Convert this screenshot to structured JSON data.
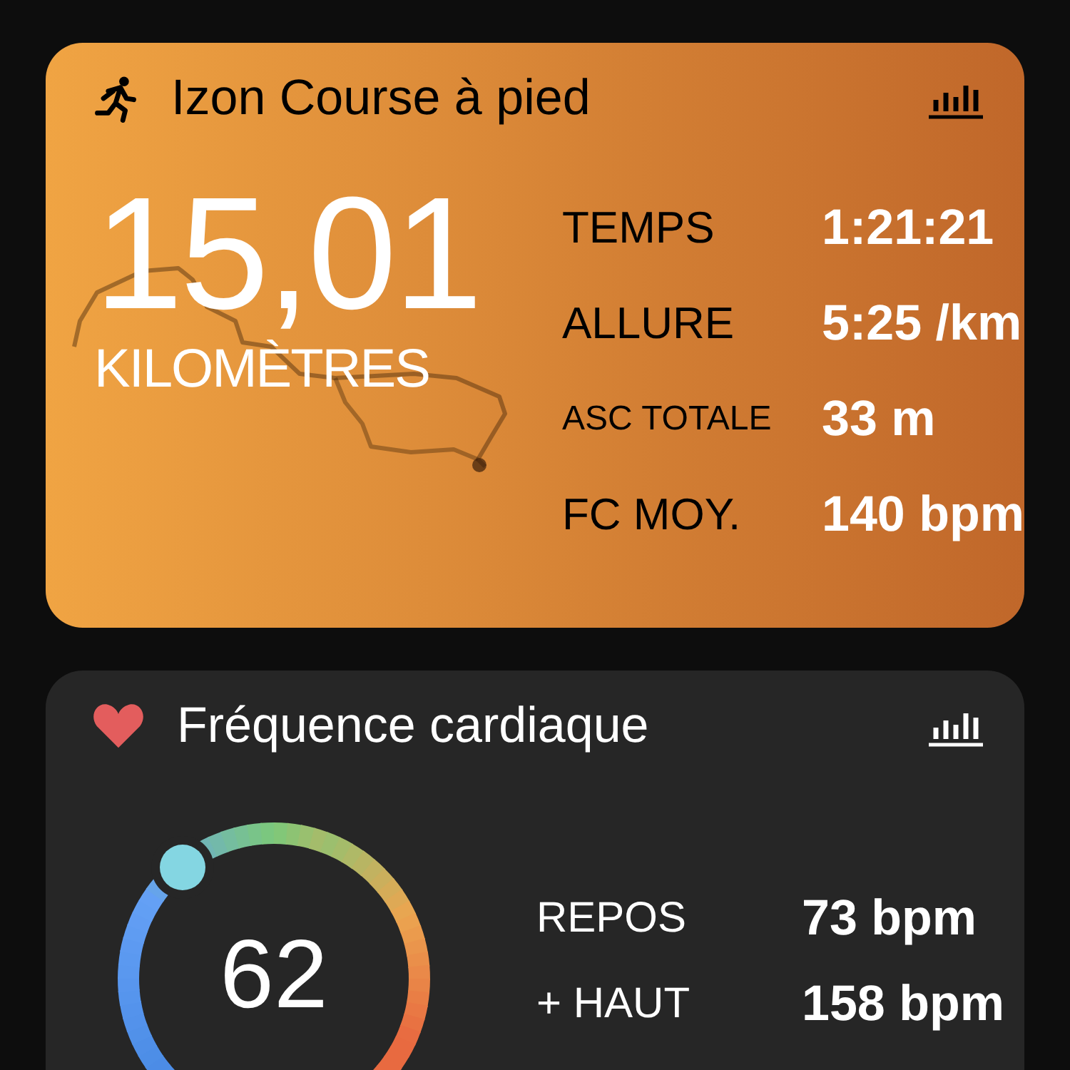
{
  "activity_card": {
    "title": "Izon Course à pied",
    "distance": "15,01",
    "distance_unit": "KILOMÈTRES",
    "stats": [
      {
        "label": "TEMPS",
        "value": "1:21:21",
        "kind": "normal"
      },
      {
        "label": "ALLURE",
        "value": "5:25 /km",
        "kind": "normal"
      },
      {
        "label": "ASC TOTALE",
        "value": "33 m",
        "kind": "small"
      },
      {
        "label": "FC MOY.",
        "value": "140 bpm",
        "kind": "normal"
      }
    ]
  },
  "heart_card": {
    "title": "Fréquence cardiaque",
    "current": "62",
    "stats": [
      {
        "label": "REPOS",
        "value": "73 bpm"
      },
      {
        "label": "+ HAUT",
        "value": "158 bpm"
      }
    ]
  }
}
